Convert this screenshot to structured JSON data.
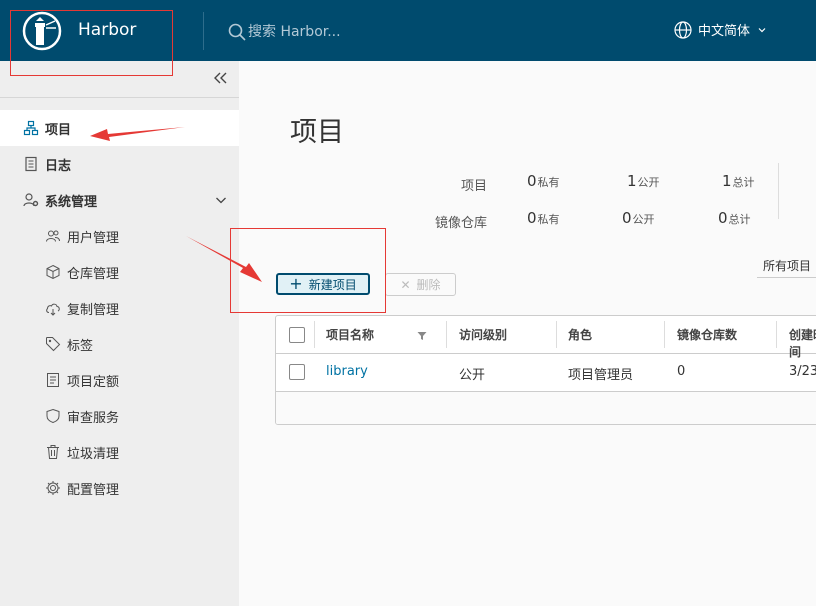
{
  "header": {
    "app_title": "Harbor",
    "search_placeholder": "搜索 Harbor...",
    "language": "中文简体",
    "bg_color": "#004b6e"
  },
  "sidebar": {
    "items": [
      {
        "label": "项目",
        "icon": "project-icon",
        "active": true
      },
      {
        "label": "日志",
        "icon": "log-icon"
      },
      {
        "label": "系统管理",
        "icon": "admin-icon",
        "expanded": true
      },
      {
        "label": "用户管理",
        "icon": "users-icon"
      },
      {
        "label": "仓库管理",
        "icon": "registry-icon"
      },
      {
        "label": "复制管理",
        "icon": "replication-icon"
      },
      {
        "label": "标签",
        "icon": "tag-icon"
      },
      {
        "label": "项目定额",
        "icon": "quota-icon"
      },
      {
        "label": "审查服务",
        "icon": "shield-icon"
      },
      {
        "label": "垃圾清理",
        "icon": "trash-icon"
      },
      {
        "label": "配置管理",
        "icon": "gear-icon"
      }
    ]
  },
  "main": {
    "title": "项目",
    "stats": {
      "projects_label": "项目",
      "repos_label": "镜像仓库",
      "projects": {
        "private": "0",
        "public": "1",
        "total": "1"
      },
      "repos": {
        "private": "0",
        "public": "0",
        "total": "0"
      },
      "private_unit": "私有",
      "public_unit": "公开",
      "total_unit": "总计"
    },
    "new_project_label": "新建项目",
    "delete_label": "删除",
    "filter_label": "所有项目",
    "table": {
      "headers": [
        "项目名称",
        "访问级别",
        "角色",
        "镜像仓库数",
        "创建时间"
      ],
      "rows": [
        {
          "name": "library",
          "access": "公开",
          "role": "项目管理员",
          "repo_count": "0",
          "created": "3/23"
        }
      ]
    }
  },
  "colors": {
    "accent": "#004b6e",
    "link": "#0072a3",
    "annotation": "#e53935"
  }
}
